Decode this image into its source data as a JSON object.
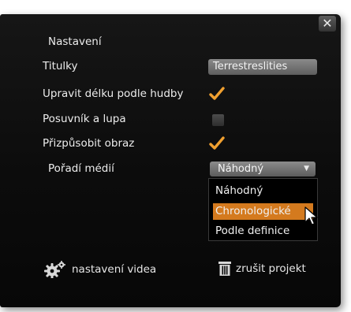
{
  "dialog": {
    "close_label": "✕",
    "heading": "Nastavení",
    "rows": {
      "titles": {
        "label": "Titulky",
        "value": "Terrestreslities"
      },
      "fit_music": {
        "label": "Upravit délku podle hudby",
        "checked": true
      },
      "slider_zoom": {
        "label": "Posuvník a lupa",
        "checked": false
      },
      "fit_image": {
        "label": "Přizpůsobit obraz",
        "checked": true
      },
      "media_order": {
        "label": "Pořadí médií",
        "selected": "Náhodný",
        "options": [
          "Náhodný",
          "Chronologické",
          "Podle definice"
        ],
        "highlighted_index": 1
      }
    },
    "footer": {
      "video_settings": "nastavení videa",
      "cancel_project": "zrušit projekt"
    }
  },
  "colors": {
    "accent": "#d47a1e",
    "check": "#f0a030"
  },
  "icons": [
    "close-icon",
    "checkmark-icon",
    "chevron-down-icon",
    "gear-icon",
    "trash-icon",
    "mouse-cursor-icon"
  ]
}
